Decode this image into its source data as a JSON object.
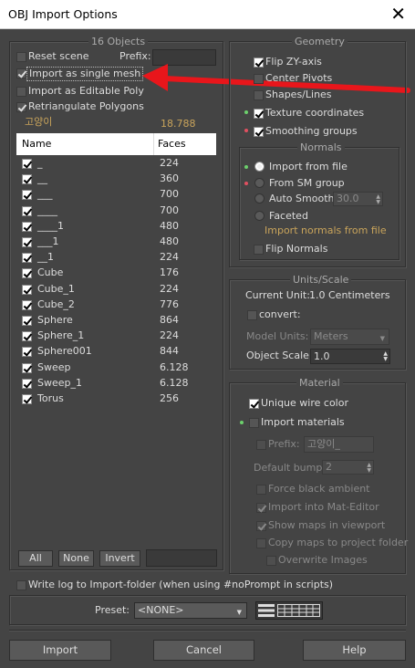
{
  "window": {
    "title": "OBJ Import Options",
    "close": "✕"
  },
  "objects": {
    "group_label": "16 Objects",
    "reset_scene": "Reset scene",
    "prefix_label": "Prefix:",
    "prefix_value": "",
    "import_single_mesh": "Import as single mesh",
    "import_editable_poly": "Import as Editable Poly",
    "retriangulate": "Retriangulate Polygons",
    "file_name": "고양이",
    "file_faces": "18.788",
    "columns": [
      "Name",
      "Faces"
    ],
    "rows": [
      {
        "name": "_",
        "faces": "224"
      },
      {
        "name": "__",
        "faces": "360"
      },
      {
        "name": "___",
        "faces": "700"
      },
      {
        "name": "____",
        "faces": "700"
      },
      {
        "name": "____1",
        "faces": "480"
      },
      {
        "name": "___1",
        "faces": "480"
      },
      {
        "name": "__1",
        "faces": "224"
      },
      {
        "name": "Cube",
        "faces": "176"
      },
      {
        "name": "Cube_1",
        "faces": "224"
      },
      {
        "name": "Cube_2",
        "faces": "776"
      },
      {
        "name": "Sphere",
        "faces": "864"
      },
      {
        "name": "Sphere_1",
        "faces": "224"
      },
      {
        "name": "Sphere001",
        "faces": "844"
      },
      {
        "name": "Sweep",
        "faces": "6.128"
      },
      {
        "name": "Sweep_1",
        "faces": "6.128"
      },
      {
        "name": "Torus",
        "faces": "256"
      }
    ],
    "btn_all": "All",
    "btn_none": "None",
    "btn_invert": "Invert",
    "filter_value": ""
  },
  "geometry": {
    "group_label": "Geometry",
    "flip_zy": "Flip ZY-axis",
    "center_pivots": "Center Pivots",
    "shapes_lines": "Shapes/Lines",
    "texture_coords": "Texture coordinates",
    "smoothing_groups": "Smoothing groups",
    "normals_label": "Normals",
    "import_from_file": "Import from file",
    "from_sm_group": "From SM group",
    "auto_smooth": "Auto Smooth:",
    "auto_smooth_value": "30.0",
    "faceted": "Faceted",
    "import_normals_note": "Import normals from file",
    "flip_normals": "Flip Normals"
  },
  "units": {
    "group_label": "Units/Scale",
    "current_unit_label": "Current Unit:",
    "current_unit_value": "1.0 Centimeters",
    "convert": "convert:",
    "model_units_label": "Model Units:",
    "model_units_value": "Meters",
    "object_scale_label": "Object Scale:",
    "object_scale_value": "1.0"
  },
  "material": {
    "group_label": "Material",
    "unique_wire_color": "Unique wire color",
    "import_materials": "Import materials",
    "prefix_label": "Prefix:",
    "prefix_value": "고양이_",
    "default_bump_label": "Default bump:",
    "default_bump_value": "2",
    "force_black_ambient": "Force black ambient",
    "import_into_mat_editor": "Import into Mat-Editor",
    "show_maps_viewport": "Show maps in viewport",
    "copy_maps_project": "Copy maps to project folder",
    "overwrite_images": "Overwrite Images"
  },
  "log": {
    "write_log": "Write log to Import-folder (when using #noPrompt in scripts)"
  },
  "preset": {
    "label": "Preset:",
    "value": "<NONE>"
  },
  "footer": {
    "import": "Import",
    "cancel": "Cancel",
    "help": "Help"
  },
  "colors": {
    "background": "#444444",
    "accent_gold": "#c9a45b",
    "arrow": "#e8161b",
    "dot_green": "#6cd06c",
    "dot_red": "#e05060"
  }
}
